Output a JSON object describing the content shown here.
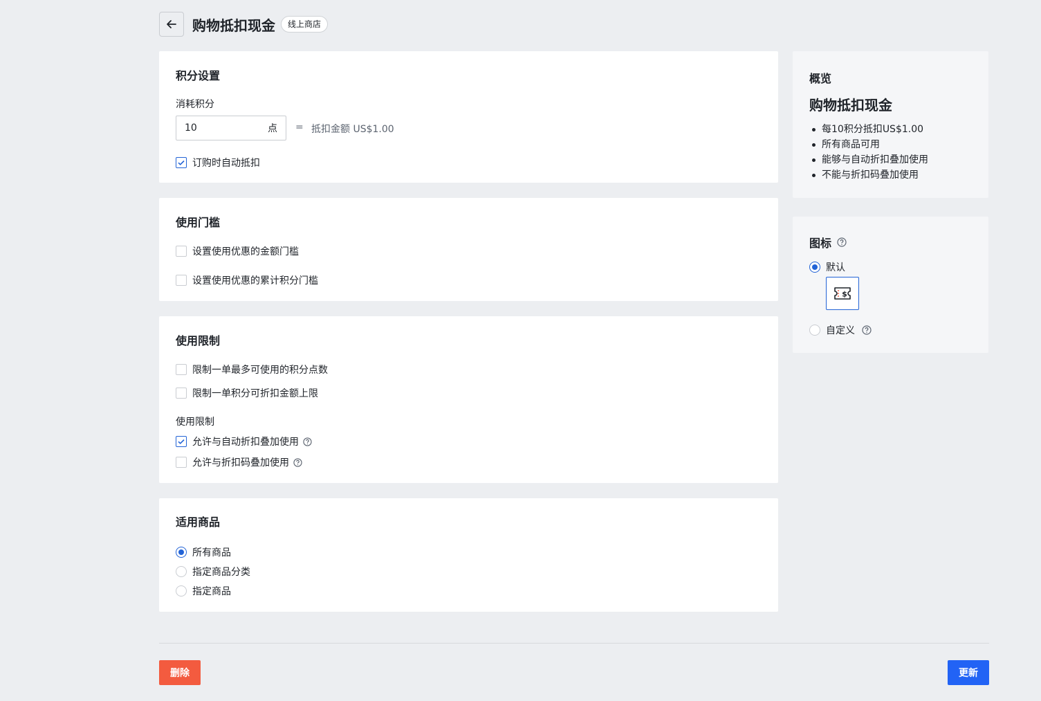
{
  "header": {
    "title": "购物抵扣现金",
    "tag": "线上商店"
  },
  "points_settings": {
    "title": "积分设置",
    "consume_label": "消耗积分",
    "points_value": "10",
    "points_unit": "点",
    "equals": "=",
    "deduct_text": "抵扣金额 US$1.00",
    "auto_deduct_label": "订购时自动抵扣",
    "auto_deduct_checked": true
  },
  "threshold": {
    "title": "使用门槛",
    "amount_threshold_label": "设置使用优惠的金额门槛",
    "points_threshold_label": "设置使用优惠的累计积分门槛"
  },
  "limits": {
    "title": "使用限制",
    "max_points_label": "限制一单最多可使用的积分点数",
    "max_amount_label": "限制一单积分可折扣金额上限",
    "sub_title": "使用限制",
    "stack_auto_label": "允许与自动折扣叠加使用",
    "stack_auto_checked": true,
    "stack_code_label": "允许与折扣码叠加使用"
  },
  "products": {
    "title": "适用商品",
    "options": [
      "所有商品",
      "指定商品分类",
      "指定商品"
    ],
    "selected": "所有商品"
  },
  "overview": {
    "title": "概览",
    "name": "购物抵扣现金",
    "bullets": [
      "每10积分抵扣US$1.00",
      "所有商品可用",
      "能够与自动折扣叠加使用",
      "不能与折扣码叠加使用"
    ]
  },
  "icon_settings": {
    "title": "图标",
    "default_label": "默认",
    "custom_label": "自定义",
    "selected": "默认"
  },
  "footer": {
    "delete_label": "删除",
    "update_label": "更新"
  },
  "colors": {
    "accent": "#2263d6",
    "danger": "#f35b3f",
    "primary_button": "#2263f5"
  }
}
